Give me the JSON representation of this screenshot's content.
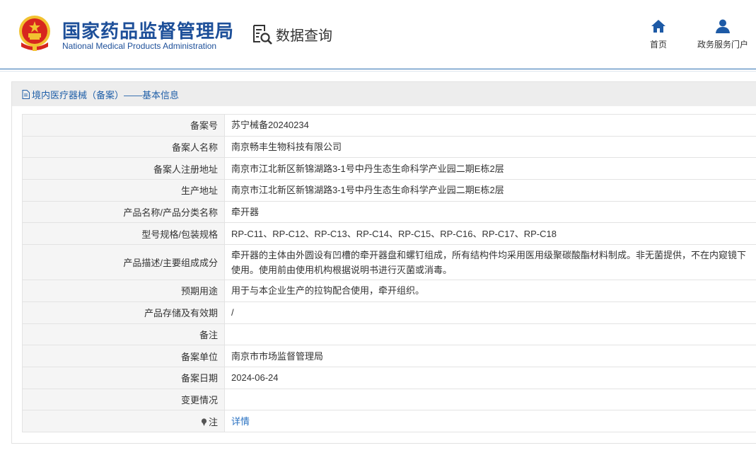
{
  "header": {
    "org_name_cn": "国家药品监督管理局",
    "org_name_en": "National Medical Products Administration",
    "section_title": "数据查询",
    "nav": [
      {
        "label": "首页",
        "icon": "home-icon"
      },
      {
        "label": "政务服务门户",
        "icon": "user-icon"
      }
    ]
  },
  "panel": {
    "title": "境内医疗器械（备案）——基本信息",
    "rows": [
      {
        "label": "备案号",
        "value": "苏宁械备20240234"
      },
      {
        "label": "备案人名称",
        "value": "南京畅丰生物科技有限公司"
      },
      {
        "label": "备案人注册地址",
        "value": "南京市江北新区新锦湖路3-1号中丹生态生命科学产业园二期E栋2层"
      },
      {
        "label": "生产地址",
        "value": "南京市江北新区新锦湖路3-1号中丹生态生命科学产业园二期E栋2层"
      },
      {
        "label": "产品名称/产品分类名称",
        "value": "牵开器"
      },
      {
        "label": "型号规格/包装规格",
        "value": "RP-C11、RP-C12、RP-C13、RP-C14、RP-C15、RP-C16、RP-C17、RP-C18"
      },
      {
        "label": "产品描述/主要组成成分",
        "value": "牵开器的主体由外圆设有凹槽的牵开器盘和螺钉组成，所有结构件均采用医用级聚碳酸酯材料制成。非无菌提供，不在内窥镜下使用。使用前由使用机构根据说明书进行灭菌或消毒。"
      },
      {
        "label": "预期用途",
        "value": "用于与本企业生产的拉钩配合使用，牵开组织。"
      },
      {
        "label": "产品存储及有效期",
        "value": "/"
      },
      {
        "label": "备注",
        "value": ""
      },
      {
        "label": "备案单位",
        "value": "南京市市场监督管理局"
      },
      {
        "label": "备案日期",
        "value": "2024-06-24"
      },
      {
        "label": "变更情况",
        "value": ""
      }
    ],
    "note_label": "注",
    "note_link": "详情"
  },
  "colors": {
    "brand_blue": "#1d4f99",
    "link_blue": "#2a72c2",
    "emblem_red": "#d7261e",
    "emblem_gold": "#f2c230"
  }
}
